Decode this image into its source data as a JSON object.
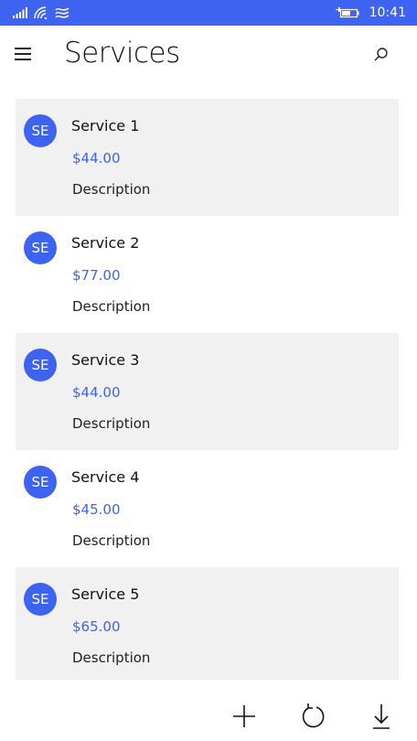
{
  "status_bar": {
    "time": "10:41",
    "icons": [
      "signal-icon",
      "wifi-icon",
      "data-sense-icon",
      "battery-icon"
    ]
  },
  "header": {
    "title": "Services",
    "menu_icon": "hamburger-menu-icon",
    "search_icon": "search-icon"
  },
  "services": [
    {
      "avatar": "SE",
      "name": "Service 1",
      "price": "$44.00",
      "description": "Description"
    },
    {
      "avatar": "SE",
      "name": "Service 2",
      "price": "$77.00",
      "description": "Description"
    },
    {
      "avatar": "SE",
      "name": "Service 3",
      "price": "$44.00",
      "description": "Description"
    },
    {
      "avatar": "SE",
      "name": "Service 4",
      "price": "$45.00",
      "description": "Description"
    },
    {
      "avatar": "SE",
      "name": "Service 5",
      "price": "$65.00",
      "description": "Description"
    }
  ],
  "app_bar": {
    "buttons": [
      "add-icon",
      "refresh-icon",
      "download-icon"
    ]
  },
  "colors": {
    "accent": "#3f63f1",
    "row_shade": "#f1f1f1",
    "background": "#ffffff"
  }
}
